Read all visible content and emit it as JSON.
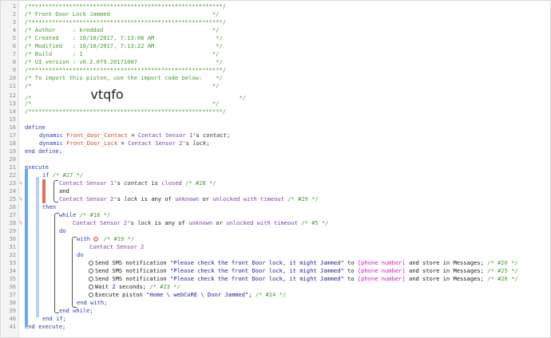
{
  "editor": {
    "header": {
      "border_top": "/*********************************************************/",
      "title": "/* Front Door Lock Jammed                              */",
      "sep1": "/*********************************************************/",
      "author": "/* Author     : kreddad                                */",
      "created": "/* Created    : 10/10/2017, 7:13:06 AM                  */",
      "modified": "/* Modified   : 10/10/2017, 7:13:22 AM                  */",
      "build": "/* Build      : 1                                      */",
      "ui_version": "/* UI version : v0.2.0f9.20171007                       */",
      "sep2": "/*********************************************************/",
      "import_note": "/* To import this piston, use the import code below:    */",
      "blank1": "/*                                                     */",
      "code_prefix": "/*              ",
      "import_code": "vtqfo",
      "code_suffix": "                         */",
      "blank2": "/*                                                     */",
      "border_bottom": "/*********************************************************/"
    },
    "define": {
      "keyword": "define",
      "line1": {
        "kw": "dynamic",
        "var": "Front_door_Contact",
        "eq": " = ",
        "dev": "Contact Sensor 1",
        "poss": "'s ",
        "attr": "contact",
        "end": ";"
      },
      "line2": {
        "kw": "dynamic",
        "var": "Front_Door_Lock",
        "eq": " = ",
        "dev": "Contact Sensor 2",
        "poss": "'s ",
        "attr": "lock",
        "end": ";"
      },
      "end": "end define;"
    },
    "execute": {
      "keyword": "execute",
      "if_kw": "if",
      "if_id": " /* #27 */",
      "cond1": {
        "dev": "Contact Sensor 1",
        "poss": "'s ",
        "attr": "contact",
        "is": " is ",
        "val": "closed",
        "id": " /* #28 */"
      },
      "and": "and",
      "cond2": {
        "dev": "Contact Sensor 2",
        "poss": "'s ",
        "attr": "lock",
        "is": " is any of ",
        "v1": "unknown",
        "or": " or ",
        "v2": "unlocked with timeout",
        "id": " /* #29 */"
      },
      "then": "then",
      "while_kw": "while",
      "while_id": " /* #18 */",
      "cond3": {
        "dev": "Contact Sensor 2",
        "poss": "'s ",
        "attr": "lock",
        "is": " is any of ",
        "v1": "unknown",
        "or": " or ",
        "v2": "unlocked with timeout",
        "id": " /* #5 */"
      },
      "do1": "do",
      "with_kw": "with",
      "with_id": " /* #19 */",
      "with_dev": "Contact Sensor 2",
      "do2": "do",
      "sms": [
        {
          "pre": "Send SMS notification ",
          "msg": "\"Please check the front Door lock, it might Jammed\"",
          "to": " to ",
          "phone": "[phone number]",
          "post": " and store in Messages;",
          "id": " /* #20 */"
        },
        {
          "pre": "Send SMS notification ",
          "msg": "\"Please check the front Door lock, it might Jammed\"",
          "to": " to ",
          "phone": "[phone number]",
          "post": " and store in Messages;",
          "id": " /* #25 */"
        },
        {
          "pre": "Send SMS notification ",
          "msg": "\"Please check the front Door lock, it might Jammed\"",
          "to": " to ",
          "phone": "[phone number]",
          "post": " and store in Messages;",
          "id": " /* #26 */"
        }
      ],
      "wait": {
        "pre": "Wait ",
        "num": "2",
        "post": " seconds;",
        "id": " /* #23 */"
      },
      "exec_piston": {
        "pre": "Execute piston ",
        "msg": "\"Home \\ webCoRE \\ Door Jammed\"",
        "post": ";",
        "id": " /* #24 */"
      },
      "end_with": "end with;",
      "end_while": "end while;",
      "end_if": "end if;",
      "end_execute": "end execute;"
    },
    "line_numbers": [
      "1",
      "2",
      "3",
      "4",
      "5",
      "6",
      "7",
      "8",
      "9",
      "10",
      "11",
      "12",
      "13",
      "14",
      "15",
      "16",
      "17",
      "18",
      "19",
      "20",
      "21",
      "22",
      "23",
      "24",
      "25",
      "26",
      "27",
      "28",
      "29",
      "30",
      "31",
      "32",
      "33",
      "34",
      "35",
      "36",
      "37",
      "38",
      "39",
      "40",
      "41"
    ],
    "warning_glyph": "ϟ",
    "colors": {
      "accent_blue": "#6aa8e8",
      "warn_red": "#e0705a",
      "comment_green": "#4a9b2f",
      "keyword_blue": "#2c3cb5"
    }
  }
}
